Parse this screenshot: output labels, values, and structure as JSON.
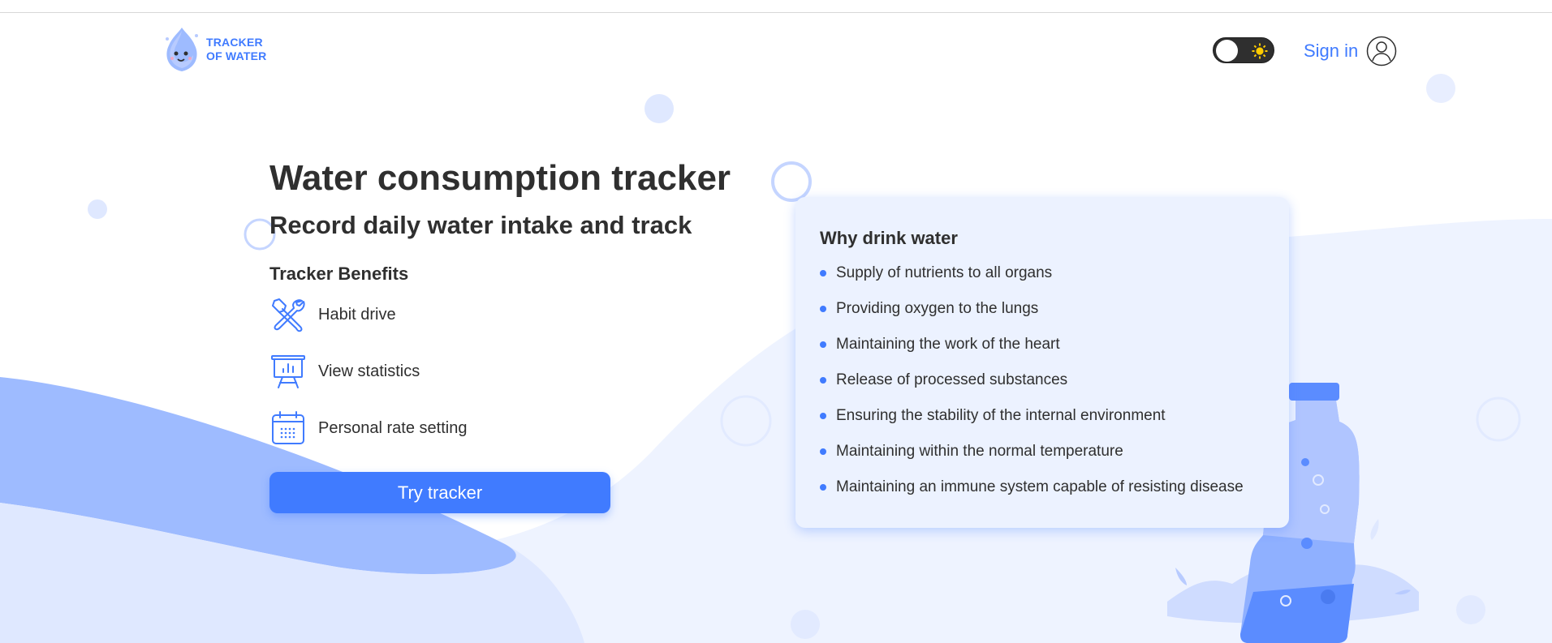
{
  "header": {
    "logo_line1": "TRACKER",
    "logo_line2": "OF WATER",
    "signin_label": "Sign in"
  },
  "hero": {
    "title": "Water consumption tracker",
    "subtitle": "Record daily water intake and track",
    "benefits_title": "Tracker Benefits",
    "benefits": [
      {
        "label": "Habit drive",
        "icon": "tools-icon"
      },
      {
        "label": "View statistics",
        "icon": "statistics-icon"
      },
      {
        "label": "Personal rate setting",
        "icon": "calendar-icon"
      }
    ],
    "cta_label": "Try tracker"
  },
  "info_card": {
    "title": "Why drink water",
    "items": [
      "Supply of nutrients to all organs",
      "Providing oxygen to the lungs",
      "Maintaining the work of the heart",
      "Release of processed substances",
      "Ensuring the stability of the internal environment",
      "Maintaining within the normal temperature",
      "Maintaining an immune system capable of resisting disease"
    ]
  },
  "colors": {
    "accent": "#407bff",
    "text": "#2f2f2f",
    "card_bg": "#ecf2ff",
    "wave_dark": "#9ebbff",
    "wave_light": "#dfe8ff"
  }
}
